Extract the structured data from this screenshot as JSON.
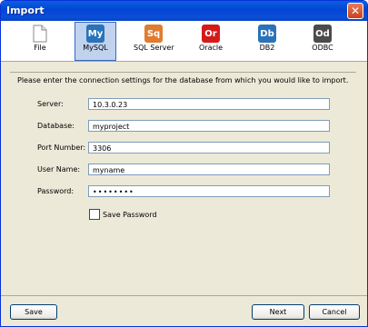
{
  "window": {
    "title": "Import",
    "close_glyph": "✕"
  },
  "toolbar": {
    "items": [
      {
        "label": "File",
        "icon": "file-icon",
        "badge": ""
      },
      {
        "label": "MySQL",
        "icon": "mysql-icon",
        "badge": "My",
        "color": "#2a73b8"
      },
      {
        "label": "SQL Server",
        "icon": "sqlserver-icon",
        "badge": "Sq",
        "color": "#e07b2f"
      },
      {
        "label": "Oracle",
        "icon": "oracle-icon",
        "badge": "Or",
        "color": "#d61a1a"
      },
      {
        "label": "DB2",
        "icon": "db2-icon",
        "badge": "Db",
        "color": "#2a73b8"
      },
      {
        "label": "ODBC",
        "icon": "odbc-icon",
        "badge": "Od",
        "color": "#4b4b4b"
      }
    ],
    "selected": "MySQL"
  },
  "form": {
    "intro": "Please enter the connection settings for the database from which you would like to import.",
    "server_label": "Server:",
    "server_value": "10.3.0.23",
    "database_label": "Database:",
    "database_value": "myproject",
    "port_label": "Port Number:",
    "port_value": "3306",
    "username_label": "User Name:",
    "username_value": "myname",
    "password_label": "Password:",
    "password_value": "••••••••",
    "save_password_label": "Save Password",
    "save_password_checked": false
  },
  "buttons": {
    "save": "Save",
    "next": "Next",
    "cancel": "Cancel"
  }
}
